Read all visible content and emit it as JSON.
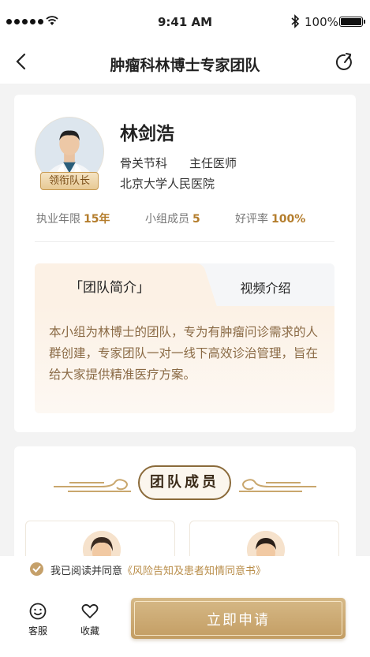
{
  "status_bar": {
    "time": "9:41 AM",
    "battery": "100%"
  },
  "nav": {
    "title": "肿瘤科林博士专家团队",
    "back_icon": "chevron-left-icon",
    "share_icon": "share-icon"
  },
  "doctor": {
    "name": "林剑浩",
    "department": "骨关节科",
    "title": "主任医师",
    "hospital": "北京大学人民医院",
    "badge": "领衔队长"
  },
  "stats": [
    {
      "label": "执业年限",
      "value": "15年"
    },
    {
      "label": "小组成员",
      "value": "5"
    },
    {
      "label": "好评率",
      "value": "100%"
    }
  ],
  "tabs": [
    {
      "label": "「团队简介」",
      "active": true
    },
    {
      "label": "视频介绍",
      "active": false
    }
  ],
  "intro": "本小组为林博士的团队，专为有肿瘤问诊需求的人群创建，专家团队一对一线下高效诊治管理，旨在给大家提供精准医疗方案。",
  "team_section": {
    "title": "团队成员"
  },
  "consent": {
    "prefix": "我已阅读并同意",
    "link": "《风险告知及患者知情同意书》"
  },
  "bottom_bar": {
    "service_label": "客服",
    "favorite_label": "收藏",
    "apply_label": "立即申请"
  },
  "colors": {
    "accent": "#c39d63",
    "gold_text": "#b47d2c",
    "tab_bg": "#fcf1e5"
  }
}
